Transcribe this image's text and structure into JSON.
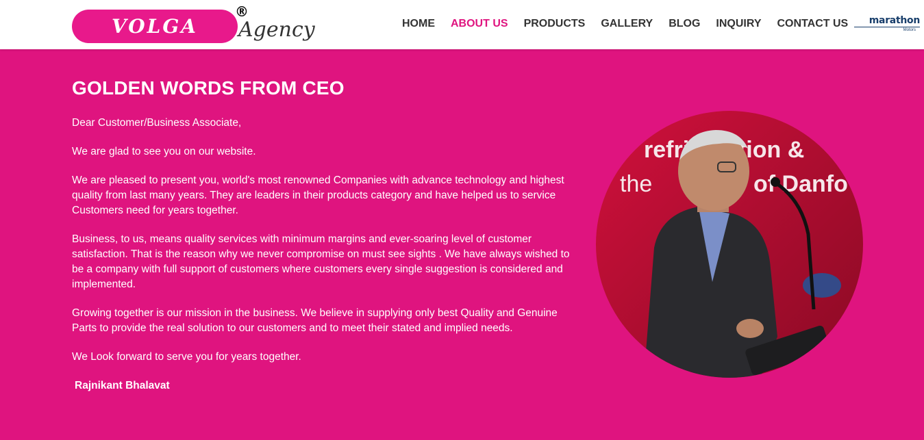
{
  "brand": {
    "logo_main": "VOLGA",
    "logo_reg": "®",
    "logo_sub": "Agency",
    "partner_name": "marathon",
    "partner_sub": "Motors"
  },
  "nav": {
    "items": [
      {
        "label": "HOME"
      },
      {
        "label": "ABOUT US"
      },
      {
        "label": "PRODUCTS"
      },
      {
        "label": "GALLERY"
      },
      {
        "label": "BLOG"
      },
      {
        "label": "INQUIRY"
      },
      {
        "label": "CONTACT US"
      }
    ],
    "active_index": 1
  },
  "main": {
    "title": "GOLDEN WORDS FROM CEO",
    "paragraphs": [
      "Dear Customer/Business Associate,",
      "We are glad to see you on our website.",
      "We are pleased to present you, world's most  renowned Companies with advance technology and highest quality from last many years. They are leaders in their products category and have helped us to service Customers need for years together.",
      "Business, to us, means quality services with minimum margins and ever-soaring level of customer satisfaction. That is the reason why we never compromise on must see sights . We have always wished to be a company with full support of customers where customers every single suggestion is considered and implemented.",
      "Growing together is our mission in the business. We believe in supplying  only  best Quality and Genuine Parts to provide the real solution to our customers and to meet their stated and implied needs.",
      "We Look forward to serve you for years together."
    ],
    "signature": "Rajnikant Bhalavat"
  },
  "photo": {
    "banner_line1": "refrigeration &",
    "banner_line2": "the",
    "banner_line2b": "of Danfo"
  },
  "colors": {
    "accent": "#df147f",
    "logo_pink": "#e8198b",
    "nav_text": "#333333",
    "partner_blue": "#183e6b"
  }
}
